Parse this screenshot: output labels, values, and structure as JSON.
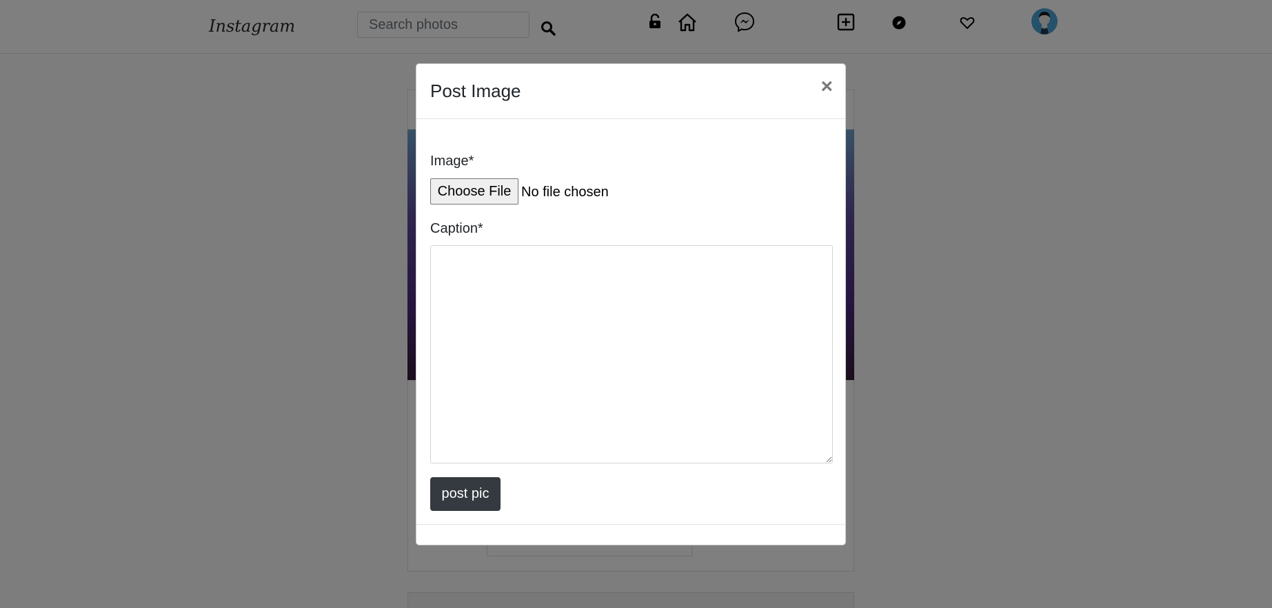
{
  "navbar": {
    "logo_text": "Instagram",
    "search_placeholder": "Search photos",
    "icons": [
      "search-icon",
      "lock-open-icon",
      "home-icon",
      "messenger-icon",
      "add-square-icon",
      "explore-compass-icon",
      "heart-icon",
      "avatar"
    ]
  },
  "modal": {
    "title": "Post Image",
    "close_label": "×",
    "image_label": "Image*",
    "file_button_label": "Choose File",
    "file_status": "No file chosen",
    "caption_label": "Caption*",
    "caption_value": "",
    "submit_label": "post pic"
  },
  "colors": {
    "overlay": "#000000",
    "button_dark": "#343a40",
    "modal_bg": "#ffffff"
  }
}
